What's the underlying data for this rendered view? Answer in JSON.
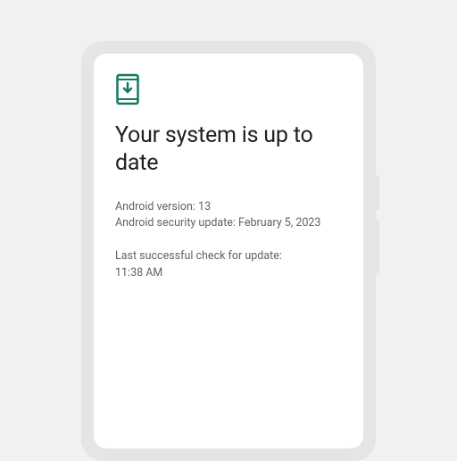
{
  "icon": {
    "name": "system-update-icon",
    "color": "#0f7b61"
  },
  "headline": "Your system is up to date",
  "version_block": {
    "android_version_label": "Android version:",
    "android_version_value": "13",
    "security_update_label": "Android security update:",
    "security_update_value": "February 5, 2023"
  },
  "check_block": {
    "last_check_label": "Last successful check for update:",
    "last_check_value": "11:38 AM"
  }
}
